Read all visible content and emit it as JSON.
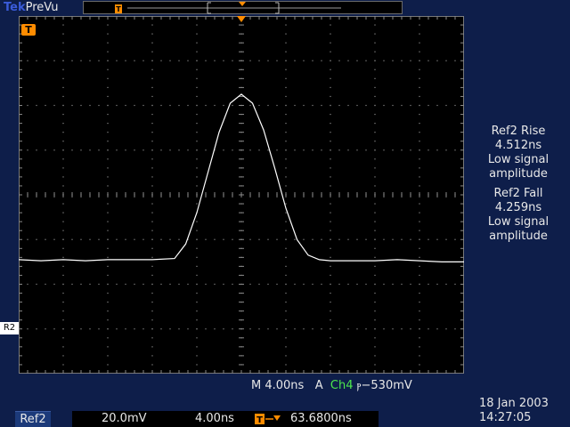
{
  "header": {
    "brand": "Tek",
    "mode": "PreVu"
  },
  "measurements": [
    {
      "label": "Ref2 Rise",
      "value": "4.512ns",
      "note": "Low signal amplitude"
    },
    {
      "label": "Ref2 Fall",
      "value": "4.259ns",
      "note": "Low signal amplitude"
    }
  ],
  "timebase": {
    "mode_prefix": "M",
    "value": "4.00ns",
    "trigger_mode": "A",
    "trigger_source": "Ch4",
    "trigger_slope_glyph": "ⲣ",
    "trigger_level": "−530mV"
  },
  "reference": {
    "tag": "Ref2",
    "volts_per_div": "20.0mV",
    "time_per_div": "4.00ns",
    "trigger_position": "63.6800ns"
  },
  "datetime": {
    "date": "18 Jan  2003",
    "time": "14:27:05"
  },
  "markers": {
    "trigger": "T",
    "ref_channel": "R2"
  },
  "colors": {
    "background": "#0e1e4a",
    "trigger_marker": "#ff8c00",
    "channel4": "#4de84d",
    "trace": "#ffffff",
    "grid": "#8a8a8a"
  },
  "waveform": {
    "type": "line",
    "units": {
      "x": "ns",
      "y": "mV"
    },
    "ylim": [
      -80,
      80
    ],
    "xlim": [
      -20,
      20
    ],
    "x": [
      -20,
      -18,
      -16,
      -14,
      -12,
      -10,
      -8,
      -6,
      -5,
      -4,
      -3,
      -2,
      -1,
      0,
      1,
      2,
      3,
      4,
      5,
      6,
      7,
      8,
      10,
      12,
      14,
      16,
      18,
      20
    ],
    "y": [
      -29,
      -29.5,
      -29,
      -29.5,
      -29,
      -29,
      -29,
      -28.5,
      -22,
      -8,
      10,
      28,
      41,
      45,
      41,
      29,
      12,
      -6,
      -20,
      -27,
      -29,
      -29.5,
      -29.5,
      -29.5,
      -29,
      -29.5,
      -30,
      -30
    ]
  }
}
